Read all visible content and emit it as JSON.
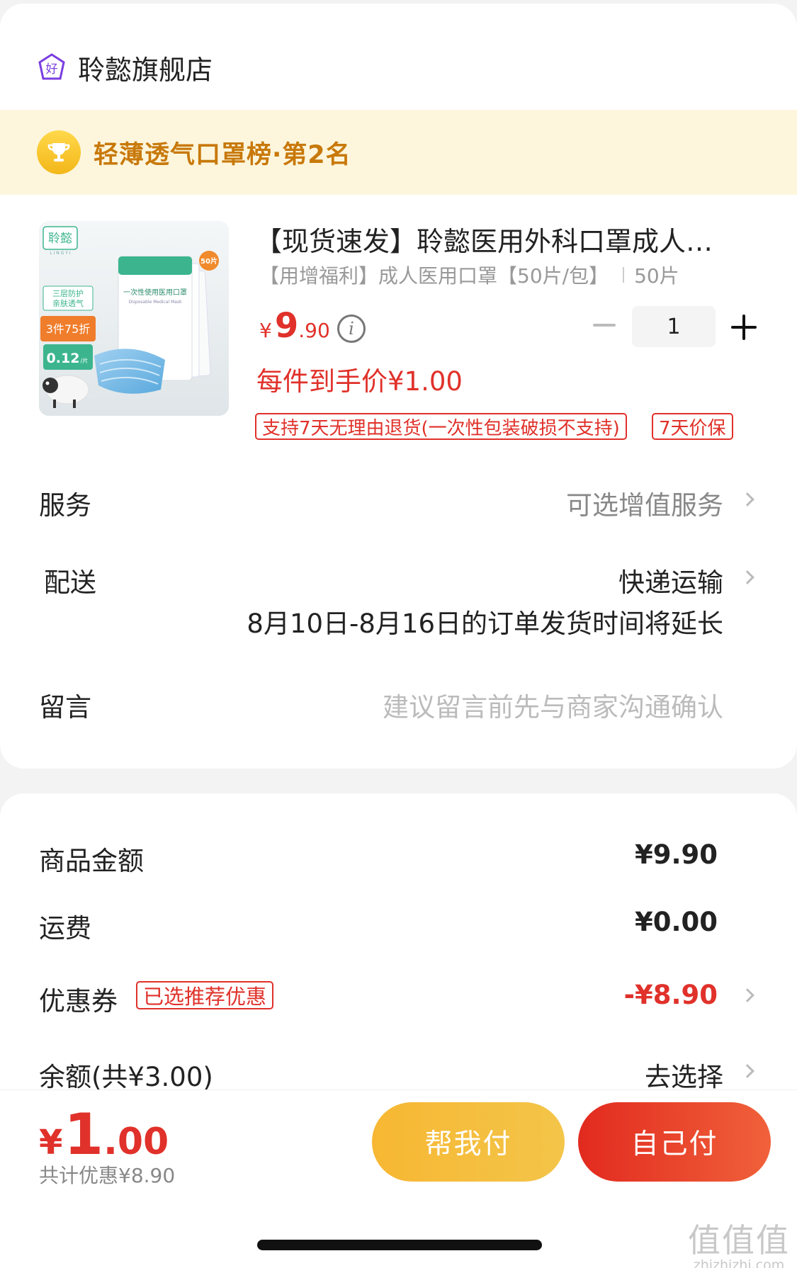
{
  "store": {
    "name": "聆懿旗舰店",
    "icon_glyph": "好"
  },
  "ranking": {
    "text": "轻薄透气口罩榜·第2名"
  },
  "product": {
    "title": "【现货速发】聆懿医用外科口罩成人…",
    "spec": "【用增福利】成人医用口罩【50片/包】",
    "spec_count": "50片",
    "price_currency": "¥",
    "price_int": "9",
    "price_dec": ".90",
    "each_price": "每件到手价¥1.00",
    "quantity": "1",
    "tags": [
      "支持7天无理由退货(一次性包装破损不支持)",
      "7天价保"
    ],
    "image": {
      "brand": "聆懿",
      "brand_sub": "L I N G Y I",
      "pack_count": "50片",
      "feature": "三层防护\n亲肤透气",
      "promo": "3件75折",
      "unit_price": "0.12",
      "unit_suffix": "/片",
      "pack_title": "一次性使用医用口罩",
      "pack_subtitle": "Disposable Medical Mask"
    }
  },
  "rows": {
    "service": {
      "label": "服务",
      "value": "可选增值服务"
    },
    "delivery": {
      "label": "配送",
      "value": "快递运输",
      "note": "8月10日-8月16日的订单发货时间将延长"
    },
    "message": {
      "label": "留言",
      "placeholder": "建议留言前先与商家沟通确认"
    }
  },
  "summary": {
    "goods_label": "商品金额",
    "goods_value": "¥9.90",
    "shipping_label": "运费",
    "shipping_value": "¥0.00",
    "coupon_label": "优惠券",
    "coupon_badge": "已选推荐优惠",
    "coupon_value": "-¥8.90",
    "balance_label": "余额(共¥3.00)",
    "balance_value": "去选择"
  },
  "footer": {
    "total_currency": "¥",
    "total_int": "1",
    "total_dec": ".00",
    "total_discount": "共计优惠¥8.90",
    "help_pay": "帮我付",
    "self_pay": "自己付"
  },
  "watermark": {
    "title": "值值值",
    "domain": "zhizhizhi.com"
  },
  "colors": {
    "accent_red": "#e0312a",
    "gold": "#c8790a",
    "help_button": "#f7b733",
    "self_button": "#e22a1f"
  }
}
